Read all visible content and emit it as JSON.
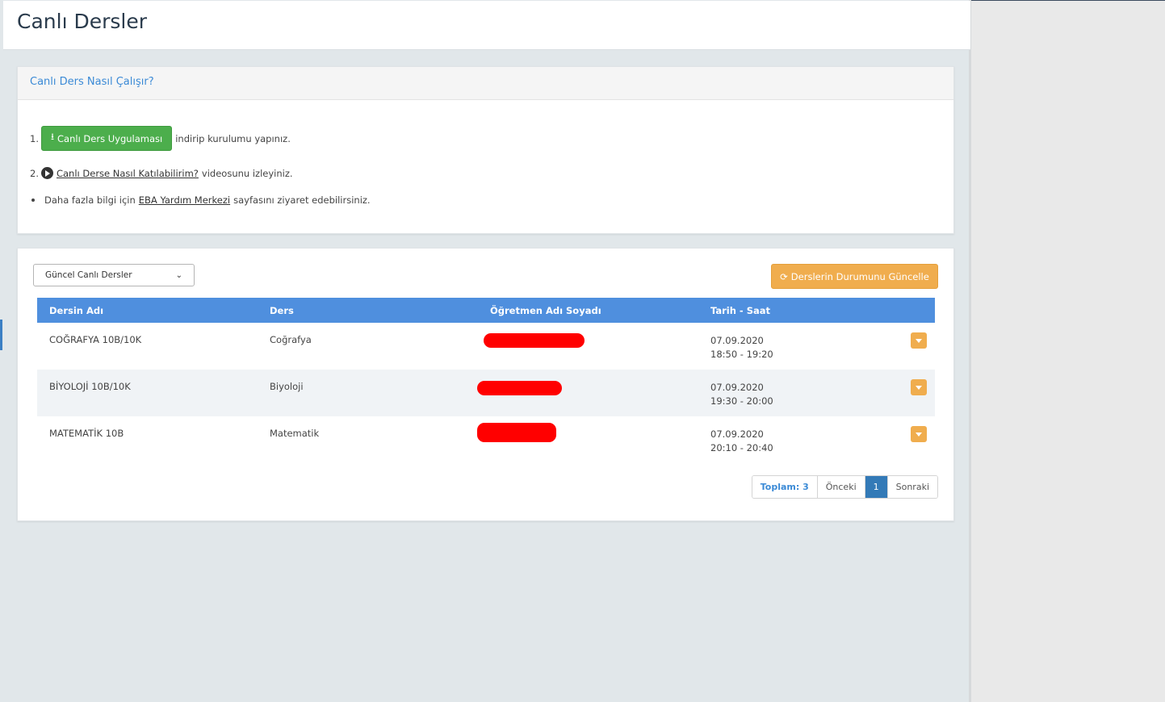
{
  "header": {
    "title": "Canlı Dersler"
  },
  "howto": {
    "title": "Canlı Ders Nasıl Çalışır?",
    "step1_num": "1.",
    "step1_button": "Canlı Ders Uygulaması",
    "step1_text": "indirip kurulumu yapınız.",
    "step2_num": "2.",
    "step2_link": "Canlı Derse Nasıl Katılabilirim?",
    "step2_text": "videosunu izleyiniz.",
    "step3_prefix": "Daha fazla bilgi için",
    "step3_link": "EBA Yardım Merkezi",
    "step3_suffix": "sayfasını ziyaret edebilirsiniz."
  },
  "controls": {
    "filter_selected": "Güncel Canlı Dersler",
    "refresh_button": "Derslerin Durumunu Güncelle"
  },
  "table": {
    "columns": [
      "Dersin Adı",
      "Ders",
      "Öğretmen Adı Soyadı",
      "Tarih - Saat"
    ],
    "rows": [
      {
        "course": "COĞRAFYA 10B/10K",
        "subject": "Coğrafya",
        "date": "07.09.2020",
        "time": "18:50 - 19:20"
      },
      {
        "course": "BİYOLOJİ 10B/10K",
        "subject": "Biyoloji",
        "date": "07.09.2020",
        "time": "19:30 - 20:00"
      },
      {
        "course": "MATEMATİK 10B",
        "subject": "Matematik",
        "date": "07.09.2020",
        "time": "20:10 - 20:40"
      }
    ]
  },
  "pagination": {
    "total": "Toplam: 3",
    "prev": "Önceki",
    "current": "1",
    "next": "Sonraki"
  },
  "colors": {
    "accent_blue": "#4f8fde",
    "green": "#4cae4c",
    "orange": "#f0ad4e",
    "redaction": "#ff0000"
  }
}
